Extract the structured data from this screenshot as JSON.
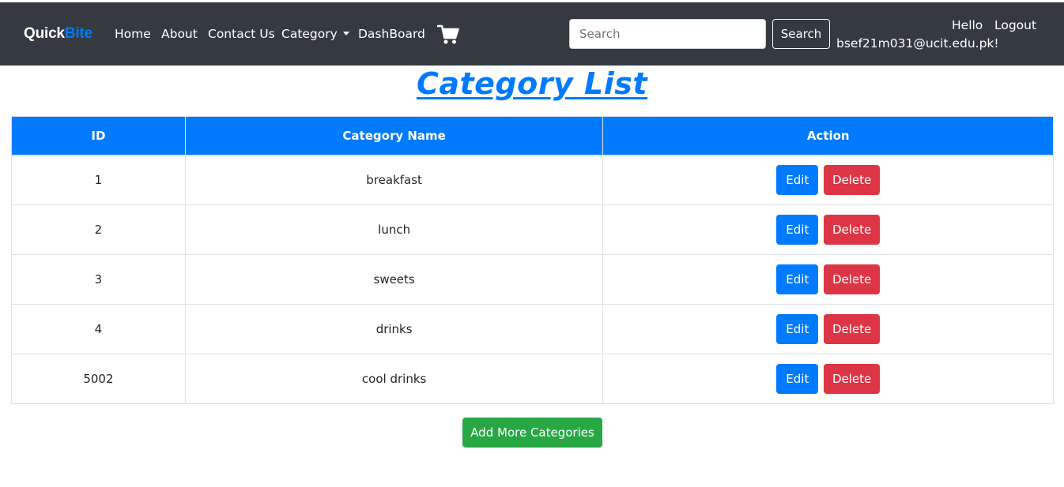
{
  "navbar": {
    "brand_part1": "Quick",
    "brand_part2": "Bite",
    "links": {
      "home": "Home",
      "about": "About",
      "contact": "Contact Us",
      "category": "Category",
      "dashboard": "DashBoard"
    },
    "cart_icon": "shopping-cart-icon",
    "search": {
      "placeholder": "Search",
      "value": "",
      "button": "Search"
    },
    "user": {
      "greeting": "Hello",
      "email": "bsef21m031@ucit.edu.pk!",
      "logout": "Logout"
    },
    "colors": {
      "background": "#343a40",
      "brand_accent": "#007bff"
    }
  },
  "main": {
    "title": "Category List",
    "table": {
      "headers": [
        "ID",
        "Category Name",
        "Action"
      ],
      "rows": [
        {
          "id": "1",
          "name": "breakfast",
          "edit": "Edit",
          "delete": "Delete"
        },
        {
          "id": "2",
          "name": "lunch",
          "edit": "Edit",
          "delete": "Delete"
        },
        {
          "id": "3",
          "name": "sweets",
          "edit": "Edit",
          "delete": "Delete"
        },
        {
          "id": "4",
          "name": "drinks",
          "edit": "Edit",
          "delete": "Delete"
        },
        {
          "id": "5002",
          "name": "cool drinks",
          "edit": "Edit",
          "delete": "Delete"
        }
      ]
    },
    "add_button": "Add More Categories",
    "colors": {
      "primary": "#007bff",
      "danger": "#dc3545",
      "success": "#28a745"
    }
  }
}
